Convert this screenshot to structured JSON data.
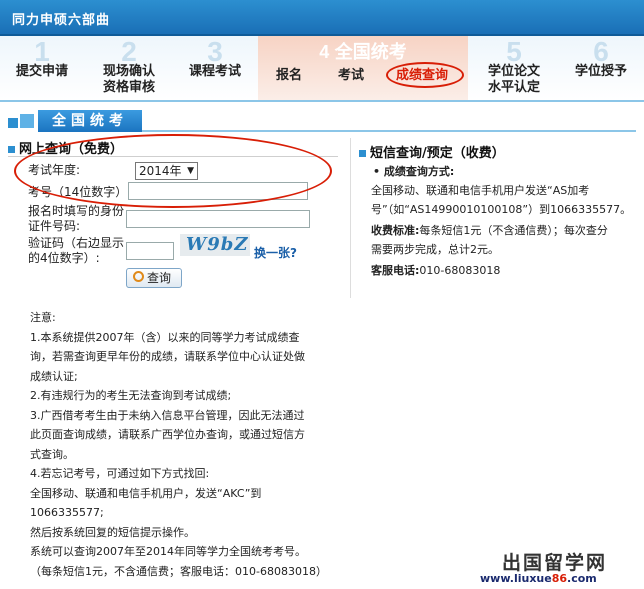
{
  "banner": {
    "title": "同力申硕六部曲"
  },
  "steps": [
    {
      "num": "1",
      "label_line1": "提交申请",
      "label_line2": ""
    },
    {
      "num": "2",
      "label_line1": "现场确认",
      "label_line2": "资格审核"
    },
    {
      "num": "3",
      "label_line1": "课程考试",
      "label_line2": ""
    },
    {
      "num": "4",
      "title": "全国统考",
      "sub": [
        "报名",
        "考试",
        "成绩查询"
      ]
    },
    {
      "num": "5",
      "label_line1": "学位论文",
      "label_line2": "水平认定"
    },
    {
      "num": "6",
      "label_line1": "学位授予",
      "label_line2": ""
    }
  ],
  "section": {
    "heading": "全国统考"
  },
  "online_query": {
    "title": "网上查询（免费）",
    "year_label": "考试年度:",
    "year_value": "2014年",
    "exam_no_label": "考号（14位数字）:",
    "id_label_1": "报名时填写的身份",
    "id_label_2": "证件号码:",
    "captcha_label_1": "验证码（右边显示",
    "captcha_label_2": "的4位数字）:",
    "captcha_text": "W9bZ",
    "change_link": "换一张?",
    "query_button": "查询"
  },
  "notes": [
    "注意:",
    "1.本系统提供2007年（含）以来的同等学力考试成绩查",
    "询，若需查询更早年份的成绩，请联系学位中心认证处做",
    "成绩认证;",
    "2.有违规行为的考生无法查询到考试成绩;",
    "3.广西借考考生由于未纳入信息平台管理，因此无法通过",
    "此页面查询成绩，请联系广西学位办查询，或通过短信方",
    "式查询。",
    "4.若忘记考号，可通过如下方式找回:",
    "全国移动、联通和电信手机用户，发送“AKC”到",
    "1066335577;",
    "然后按系统回复的短信提示操作。",
    "系统可以查询2007年至2014年同等学力全国统考考号。",
    "（每条短信1元，不含通信费；客服电话：010-68083018）"
  ],
  "sms_query": {
    "title": "短信查询/预定（收费）",
    "method_label": "• 成绩查询方式:",
    "method_line1": "全国移动、联通和电信手机用户发送“AS加考",
    "method_line2": "号”（如“AS14990010100108”）到1066335577。",
    "fee_label": "收费标准:",
    "fee_text_1": "每条短信1元（不含通信费）；每次查分",
    "fee_text_2": "需要两步完成，总计2元。",
    "phone_label": "客服电话:",
    "phone_value": "010-68083018"
  },
  "watermark": {
    "name": "出国留学网",
    "url_prefix": "www.liuxue",
    "url_num": "86",
    "url_suffix": ".com"
  },
  "colors": {
    "brand_blue": "#1a6fb6",
    "highlight_red": "#d81e06",
    "active_step_bg": "#f7d3c4"
  }
}
